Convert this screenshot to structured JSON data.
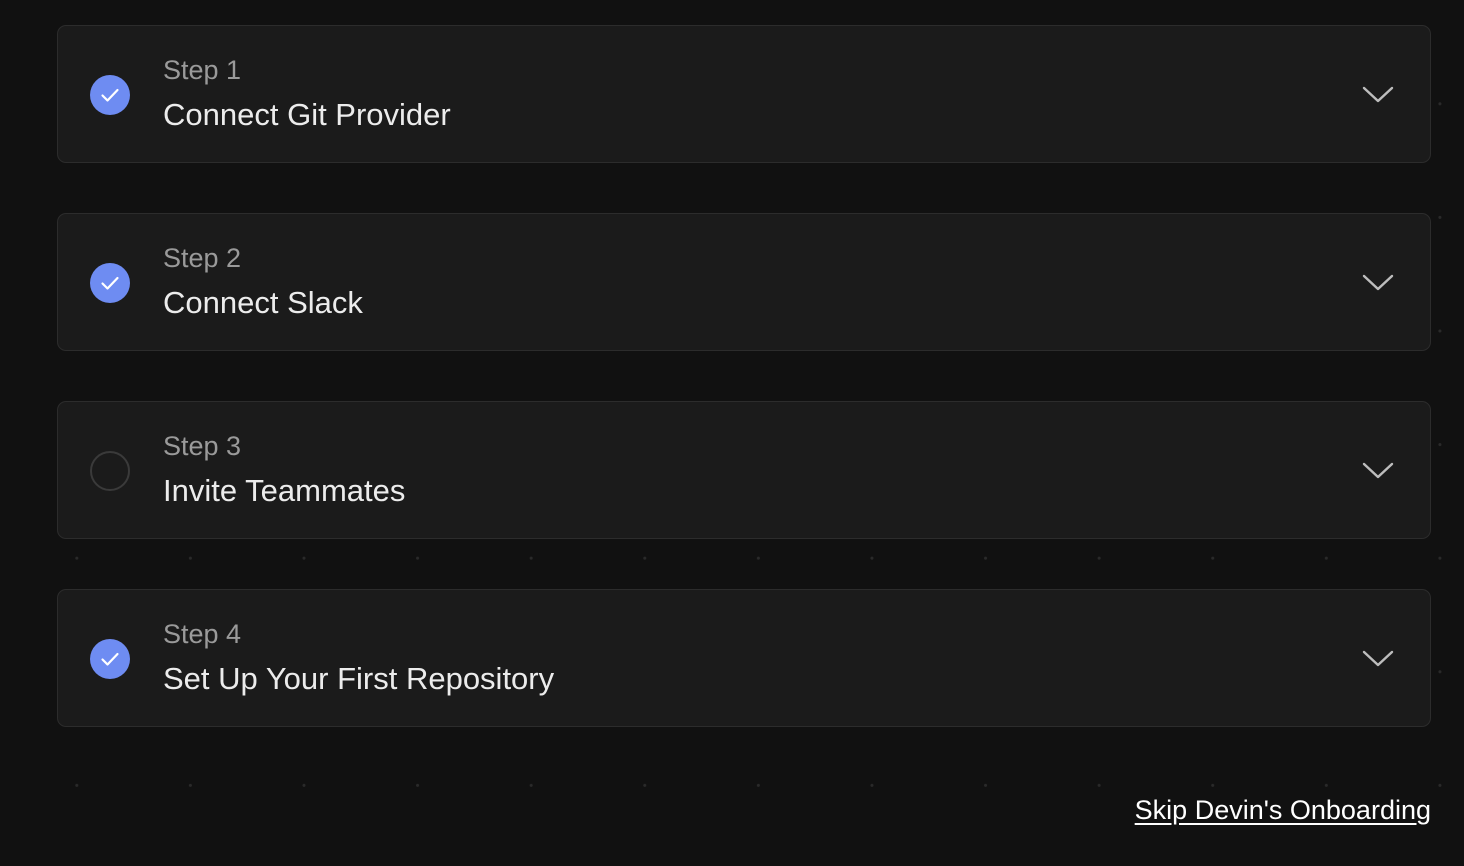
{
  "steps": [
    {
      "number_label": "Step 1",
      "title": "Connect Git Provider",
      "status": "completed",
      "status_icon": "check-icon",
      "toggle_icon": "chevron-down-icon"
    },
    {
      "number_label": "Step 2",
      "title": "Connect Slack",
      "status": "completed",
      "status_icon": "check-icon",
      "toggle_icon": "chevron-down-icon"
    },
    {
      "number_label": "Step 3",
      "title": "Invite Teammates",
      "status": "incomplete",
      "status_icon": "empty-circle-icon",
      "toggle_icon": "chevron-down-icon"
    },
    {
      "number_label": "Step 4",
      "title": "Set Up Your First Repository",
      "status": "completed",
      "status_icon": "check-icon",
      "toggle_icon": "chevron-down-icon"
    }
  ],
  "skip_link": {
    "label": "Skip Devin's Onboarding"
  },
  "colors": {
    "background": "#111111",
    "card": "#1b1b1b",
    "card_border": "#2c2c2c",
    "accent": "#6e8cf2",
    "title_text": "#ececec",
    "subtitle_text": "#9a9a9a"
  }
}
